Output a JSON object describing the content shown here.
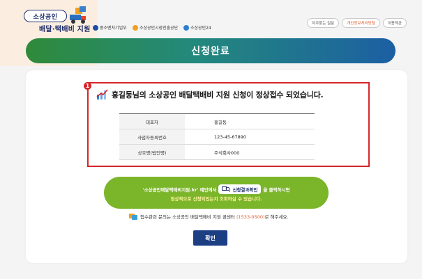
{
  "header": {
    "logo_top": "소상공인",
    "logo_sub": "배달·택배비 지원",
    "agencies": [
      {
        "label": "중소벤처기업부",
        "color": "#1d4fa3"
      },
      {
        "label": "소상공인시장진흥공단",
        "color": "#f0a020"
      },
      {
        "label": "소상공인24",
        "color": "#2a7fd0"
      }
    ],
    "links": [
      "자주묻는 질문",
      "개인정보처리방침",
      "이용약관"
    ]
  },
  "banner": {
    "title": "신청완료"
  },
  "callout_number": "1",
  "confirmation": {
    "message": "홍길동님의 소상공인 배달택배비 지원 신청이 정상접수 되었습니다.",
    "rows": [
      {
        "label": "대표자",
        "value": "홍길동"
      },
      {
        "label": "사업자등록번호",
        "value": "123-45-67890"
      },
      {
        "label": "상호명(법인명)",
        "value": "주식회사000"
      }
    ]
  },
  "notice": {
    "line1_a": "'소상공인배달택배비지원.kr' 메인에서",
    "button_label": "신청결과확인",
    "line1_b": "을 클릭하시면",
    "line2": "정상적으로 신청되었는지 조회하실 수 있습니다."
  },
  "contact": {
    "prefix": "접수관련 문의는 소상공인 배달택배비 지원 콜센터",
    "phone": "(1533-0500)",
    "suffix": "로 해주세요."
  },
  "confirm_button": "확인",
  "colors": {
    "accent_red": "#d6262b",
    "banner_green": "#2f8a3a",
    "banner_blue": "#1c5fa3",
    "notice_green": "#7bb52a",
    "button_navy": "#1c3f84"
  }
}
